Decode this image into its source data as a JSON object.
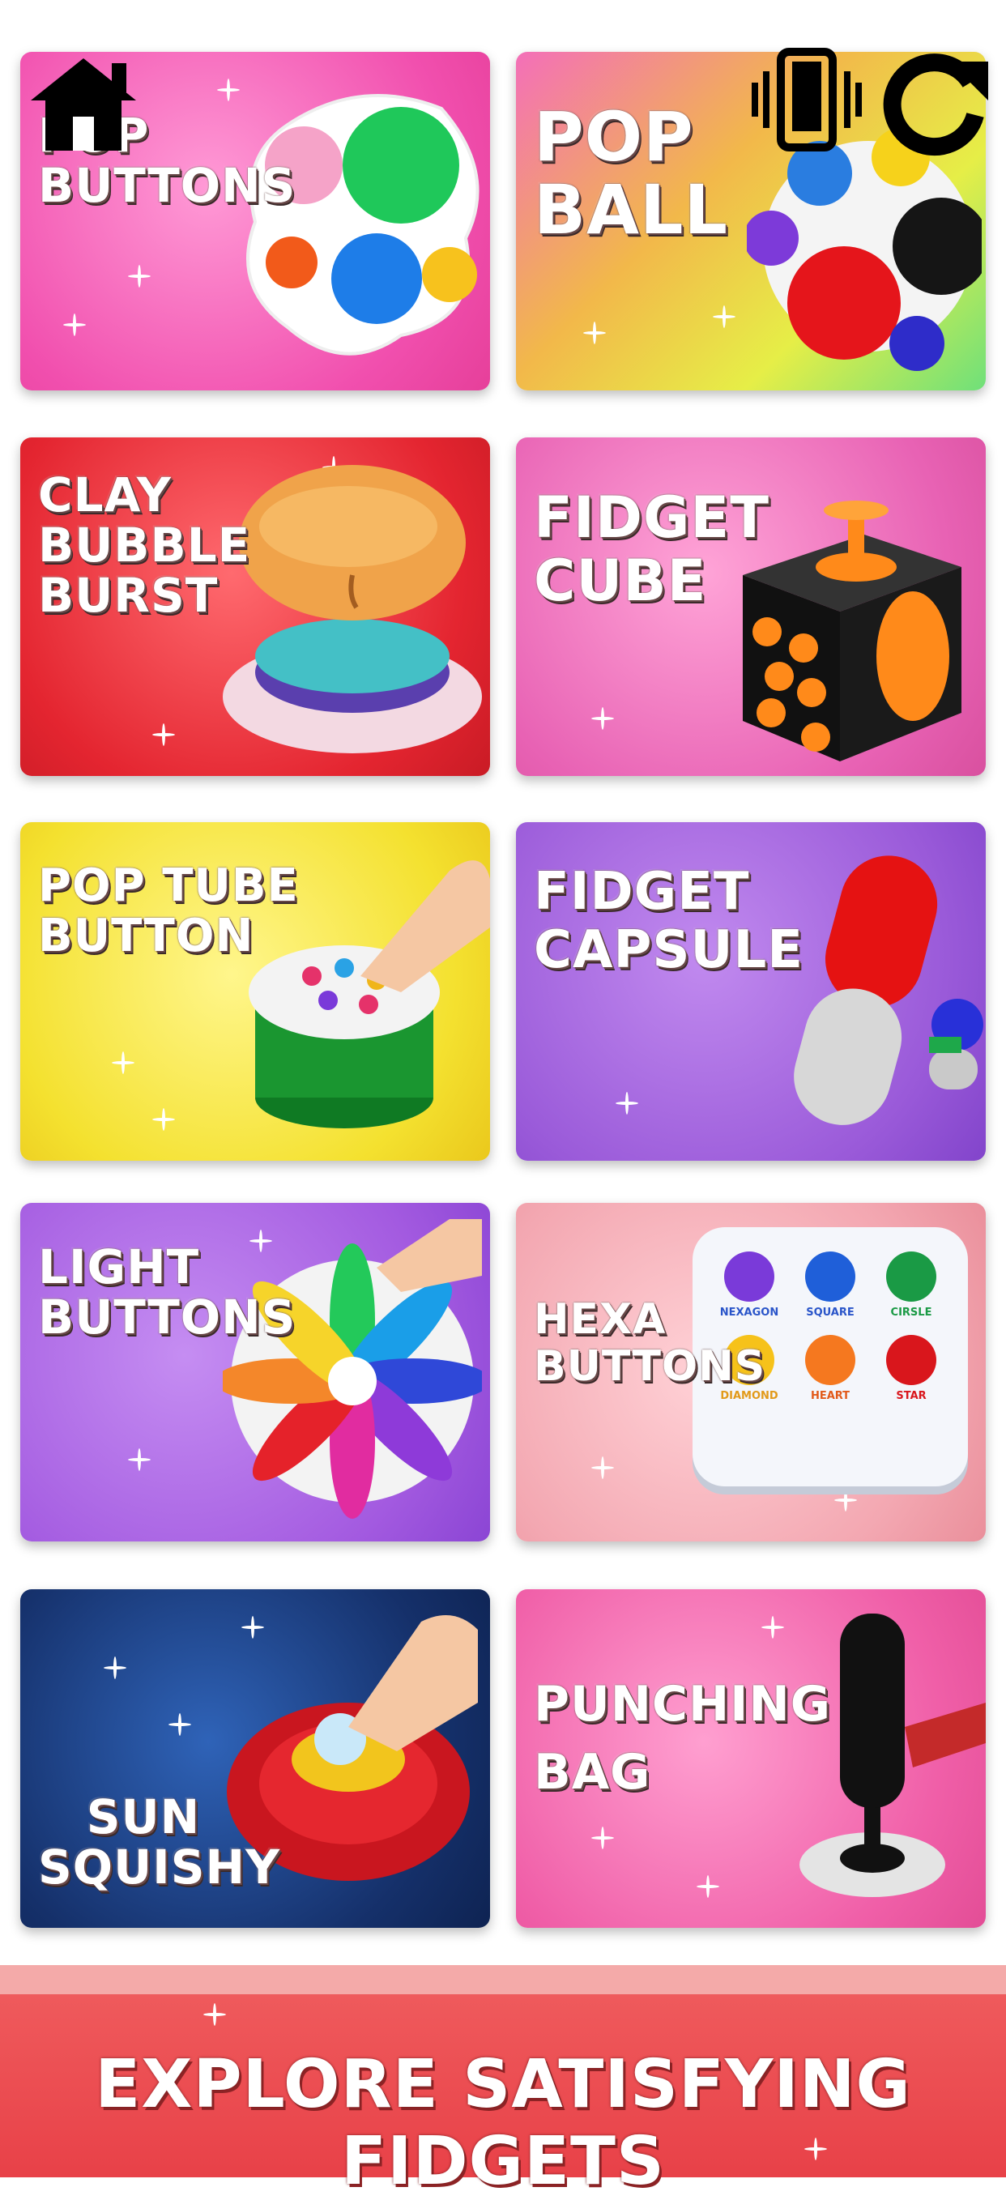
{
  "top_bar": {
    "home_icon": "home-icon",
    "vibration_icon": "phone-vibrate-icon",
    "refresh_icon": "refresh-icon"
  },
  "cards": [
    {
      "id": "pop-buttons",
      "title": "POP\nBUTTONS",
      "color": "#f25fb0"
    },
    {
      "id": "pop-ball",
      "title": "POP\nBALL",
      "color": "#e9e24a"
    },
    {
      "id": "clay-bubble-burst",
      "title": "CLAY\nBUBBLE\nBURST",
      "color": "#e8323a"
    },
    {
      "id": "fidget-cube",
      "title": "FIDGET\nCUBE",
      "color": "#e764b3"
    },
    {
      "id": "pop-tube-button",
      "title": "POP TUBE\nBUTTON",
      "color": "#f0de33"
    },
    {
      "id": "fidget-capsule",
      "title": "FIDGET\nCAPSULE",
      "color": "#9a5ad9"
    },
    {
      "id": "light-buttons",
      "title": "LIGHT\nBUTTONS",
      "color": "#a35ae0"
    },
    {
      "id": "hexa-buttons",
      "title": "HEXA\nBUTTONS",
      "color": "#f3a7b1"
    },
    {
      "id": "sun-squishy",
      "title": "SUN\nSQUISHY",
      "color": "#15306a"
    },
    {
      "id": "punching-bag",
      "title": "PUNCHING\nBAG",
      "color": "#f05fa8"
    }
  ],
  "hexa_labels": [
    "NEXAGON",
    "SQUARE",
    "CIRSLE",
    "DIAMOND",
    "HEART",
    "STAR"
  ],
  "banner": {
    "text": "EXPLORE SATISFYING FIDGETS"
  }
}
